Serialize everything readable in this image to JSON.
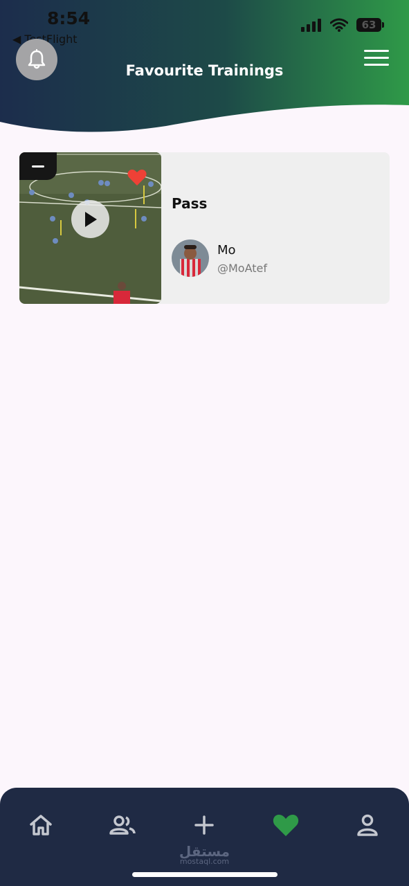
{
  "status_bar": {
    "time": "8:54",
    "back_app": "◀ TestFlight",
    "battery": "63"
  },
  "header": {
    "title": "Favourite Trainings",
    "gradient_start": "#1c2d4c",
    "gradient_end": "#2f9a48"
  },
  "trainings": [
    {
      "name": "Pass",
      "user_name": "Mo",
      "user_handle": "@MoAtef",
      "favorited": true
    }
  ],
  "icons": {
    "bell": "bell-icon",
    "menu": "hamburger-menu-icon",
    "play": "play-icon",
    "heart": "heart-icon",
    "remove": "minus-icon"
  },
  "bottom_nav": {
    "items": [
      {
        "name": "home",
        "icon": "home-icon"
      },
      {
        "name": "people",
        "icon": "people-icon"
      },
      {
        "name": "add",
        "icon": "plus-icon"
      },
      {
        "name": "favourites",
        "icon": "heart-icon",
        "active": true
      },
      {
        "name": "profile",
        "icon": "person-icon"
      }
    ],
    "active_color": "#2f9a48",
    "inactive_color": "#c4c7cf"
  },
  "watermark": {
    "arabic": "مستقل",
    "latin": "mostaql.com"
  }
}
